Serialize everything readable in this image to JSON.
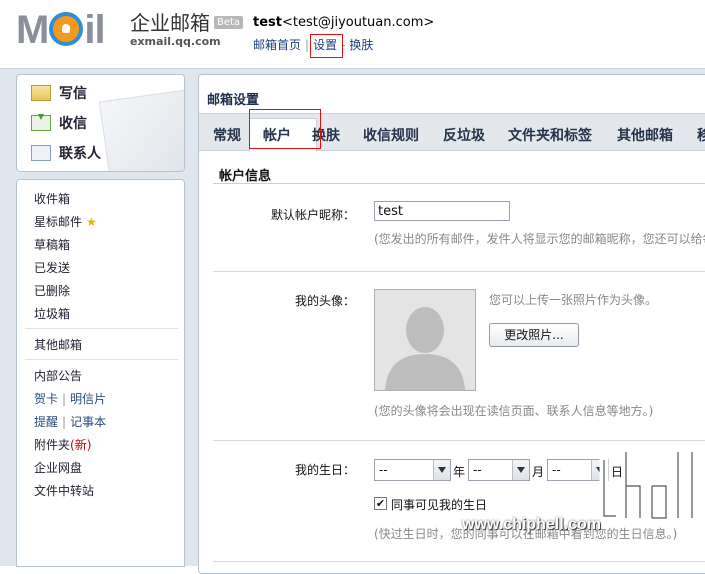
{
  "header": {
    "logo_mark": "M  il",
    "logo_cn": "企业邮箱",
    "logo_en": "exmail.qq.com",
    "beta": "Beta",
    "user_name": "test",
    "user_email": "<test@jiyoutuan.com>",
    "links": {
      "home": "邮箱首页",
      "settings": "设置",
      "switch": "换肤"
    }
  },
  "quick_actions": {
    "write": "写信",
    "receive": "收信",
    "contacts": "联系人"
  },
  "nav": {
    "inbox": "收件箱",
    "starred": "星标邮件",
    "drafts": "草稿箱",
    "sent": "已发送",
    "deleted": "已删除",
    "spam": "垃圾箱",
    "other_mailboxes": "其他邮箱",
    "announcements": "内部公告",
    "cards": "贺卡",
    "postcards": "明信片",
    "reminders": "提醒",
    "notes": "记事本",
    "attachments": "附件夹",
    "attachments_new": "(新)",
    "netdisk": "企业网盘",
    "file_transfer": "文件中转站"
  },
  "settings": {
    "title": "邮箱设置",
    "tabs": [
      "常规",
      "帐户",
      "换肤",
      "收信规则",
      "反垃圾",
      "文件夹和标签",
      "其他邮箱",
      "移"
    ],
    "active_tab": "帐户",
    "section_title": "帐户信息",
    "nickname_label": "默认帐户昵称：",
    "nickname_value": "test",
    "nickname_hint": "(您发出的所有邮件，发件人将显示您的邮箱昵称，您还可以给每",
    "avatar_label": "我的头像：",
    "avatar_hint": "您可以上传一张照片作为头像。",
    "change_photo": "更改照片...",
    "avatar_note": "(您的头像将会出现在读信页面、联系人信息等地方。)",
    "birthday_label": "我的生日：",
    "year_value": "--",
    "year_unit": "年",
    "month_value": "--",
    "month_unit": "月",
    "day_value": "--",
    "day_unit": "日",
    "share_checkbox": "✔",
    "share_label": "同事可见我的生日",
    "birthday_note": "(快过生日时，您的同事可以在邮箱中看到您的生日信息。)"
  },
  "watermark": {
    "text": "www.chiphell.com"
  }
}
